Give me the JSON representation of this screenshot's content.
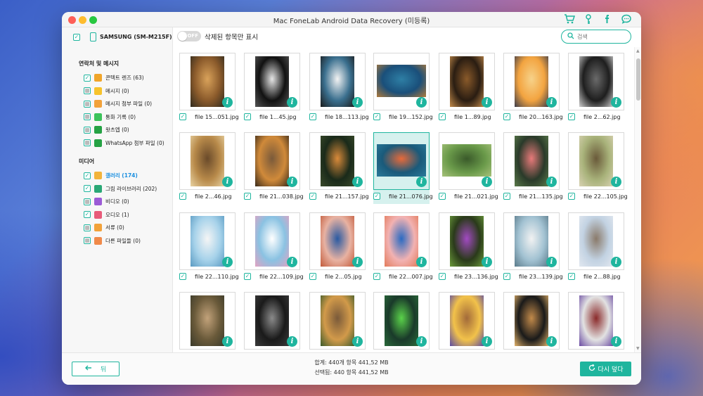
{
  "window": {
    "title": "Mac FoneLab Android Data Recovery (미등록)"
  },
  "toolbar_icons": [
    "cart-icon",
    "key-icon",
    "facebook-icon",
    "chat-icon"
  ],
  "device": {
    "name": "SAMSUNG (SM-M215F)"
  },
  "sections": [
    {
      "title": "연락처 및 메시지",
      "items": [
        {
          "label": "콘텍트 렌즈 (63)",
          "icon": "contacts-icon",
          "color": "#f0a52a",
          "state": "checked"
        },
        {
          "label": "메시지 (0)",
          "icon": "message-icon",
          "color": "#f7c32b",
          "state": "indeterminate"
        },
        {
          "label": "메시지 첨부 파일 (0)",
          "icon": "attachment-icon",
          "color": "#f2a23a",
          "state": "indeterminate"
        },
        {
          "label": "통화 기록 (0)",
          "icon": "phone-icon",
          "color": "#3cc35a",
          "state": "indeterminate"
        },
        {
          "label": "왓츠엡 (0)",
          "icon": "whatsapp-icon",
          "color": "#25a244",
          "state": "indeterminate"
        },
        {
          "label": "WhatsApp 첨부 파일 (0)",
          "icon": "whatsapp-attachment-icon",
          "color": "#25a244",
          "state": "indeterminate"
        }
      ]
    },
    {
      "title": "미디어",
      "items": [
        {
          "label": "갤러리 (174)",
          "icon": "gallery-icon",
          "color": "#f2b33b",
          "state": "checked",
          "active": true
        },
        {
          "label": "그림 라이브러리 (202)",
          "icon": "picture-library-icon",
          "color": "#2aa876",
          "state": "checked"
        },
        {
          "label": "비디오 (0)",
          "icon": "video-icon",
          "color": "#9b5bd6",
          "state": "indeterminate"
        },
        {
          "label": "오디오 (1)",
          "icon": "audio-icon",
          "color": "#e85b7a",
          "state": "checked"
        },
        {
          "label": "서류 (0)",
          "icon": "document-icon",
          "color": "#f2a23a",
          "state": "indeterminate"
        },
        {
          "label": "다른 파일들 (0)",
          "icon": "other-files-icon",
          "color": "#f08a4a",
          "state": "indeterminate"
        }
      ]
    }
  ],
  "topbar": {
    "toggle_text": "OFF",
    "toggle_label": "삭제된 항목만 표시",
    "search_placeholder": "검색"
  },
  "files": [
    {
      "name": "file 15...051.jpg",
      "colors": [
        "#8a5a2b",
        "#d9a25a",
        "#2f2a1e"
      ]
    },
    {
      "name": "file 1...45.jpg",
      "colors": [
        "#111111",
        "#e6e6e6",
        "#555555"
      ]
    },
    {
      "name": "file 18...113.jpg",
      "colors": [
        "#3a6f8e",
        "#f3f3f3",
        "#1a1a1a"
      ]
    },
    {
      "name": "file 19...152.jpg",
      "colors": [
        "#1a4f7a",
        "#2e7fa5",
        "#b07a3a"
      ]
    },
    {
      "name": "file 1...89.jpg",
      "colors": [
        "#2a1d12",
        "#8a5a2a",
        "#c28a4a"
      ]
    },
    {
      "name": "file 20...163.jpg",
      "colors": [
        "#f3a440",
        "#f6d28a",
        "#3b3b4a"
      ]
    },
    {
      "name": "file 2...62.jpg",
      "colors": [
        "#1e1e1e",
        "#6a6a6a",
        "#cfcfcf"
      ]
    },
    {
      "name": "file 2...46.jpg",
      "colors": [
        "#b88a4a",
        "#6a4a2a",
        "#e8d2a2"
      ]
    },
    {
      "name": "file 21...038.jpg",
      "colors": [
        "#d08a3a",
        "#7a5a3a",
        "#3a2a1a"
      ]
    },
    {
      "name": "file 21...157.jpg",
      "colors": [
        "#1a2a1a",
        "#d98a3a",
        "#3a4a2a"
      ]
    },
    {
      "name": "file 21...076.jpg",
      "colors": [
        "#1a5a7a",
        "#e86a3a",
        "#2a7a9a"
      ]
    },
    {
      "name": "file 21...021.jpg",
      "colors": [
        "#6a9a4a",
        "#3a5a2a",
        "#a6c27a"
      ]
    },
    {
      "name": "file 21...135.jpg",
      "colors": [
        "#2a3a2a",
        "#e87a7a",
        "#5a7a4a"
      ]
    },
    {
      "name": "file 22...105.jpg",
      "colors": [
        "#a8b27a",
        "#6a5a3a",
        "#d8d2b2"
      ]
    },
    {
      "name": "file 22...110.jpg",
      "colors": [
        "#a6d2ea",
        "#f5f5f5",
        "#5a9ac2"
      ]
    },
    {
      "name": "file 22...109.jpg",
      "colors": [
        "#8ac2e2",
        "#ffffff",
        "#e2a2c2"
      ]
    },
    {
      "name": "file 2...05.jpg",
      "colors": [
        "#e8b2a2",
        "#2a5aa2",
        "#c25a3a"
      ]
    },
    {
      "name": "file 22...007.jpg",
      "colors": [
        "#f2b2b2",
        "#2a6ac2",
        "#e27a5a"
      ]
    },
    {
      "name": "file 23...136.jpg",
      "colors": [
        "#2a3a1a",
        "#a24ac2",
        "#6a9a3a"
      ]
    },
    {
      "name": "file 23...139.jpg",
      "colors": [
        "#a2c2d2",
        "#f2f2f2",
        "#5a7a8a"
      ]
    },
    {
      "name": "file 2...88.jpg",
      "colors": [
        "#c2d2e2",
        "#8a7a6a",
        "#e2e8f0"
      ]
    },
    {
      "name": "",
      "colors": [
        "#6a5a3a",
        "#c2a27a",
        "#3a3a2a"
      ]
    },
    {
      "name": "",
      "colors": [
        "#1a1a1a",
        "#8a8a8a",
        "#3a3a3a"
      ]
    },
    {
      "name": "",
      "colors": [
        "#d29a4a",
        "#7a5a3a",
        "#3a5a2a"
      ]
    },
    {
      "name": "",
      "colors": [
        "#1a3a2a",
        "#5ad24a",
        "#2a6a3a"
      ]
    },
    {
      "name": "",
      "colors": [
        "#f2c24a",
        "#a26a3a",
        "#5a4aa2"
      ]
    },
    {
      "name": "",
      "colors": [
        "#1a1a1a",
        "#c28a4a",
        "#e2b26a"
      ]
    },
    {
      "name": "",
      "colors": [
        "#e2e2e2",
        "#8a2a2a",
        "#6a4aa2"
      ]
    }
  ],
  "selected_index": 10,
  "footer": {
    "back_label": "뒤",
    "total": "합계: 440개 항목 441,52 MB",
    "selected": "선택됨: 440 항목 441,52 MB",
    "recover_label": "다시 덮다"
  }
}
